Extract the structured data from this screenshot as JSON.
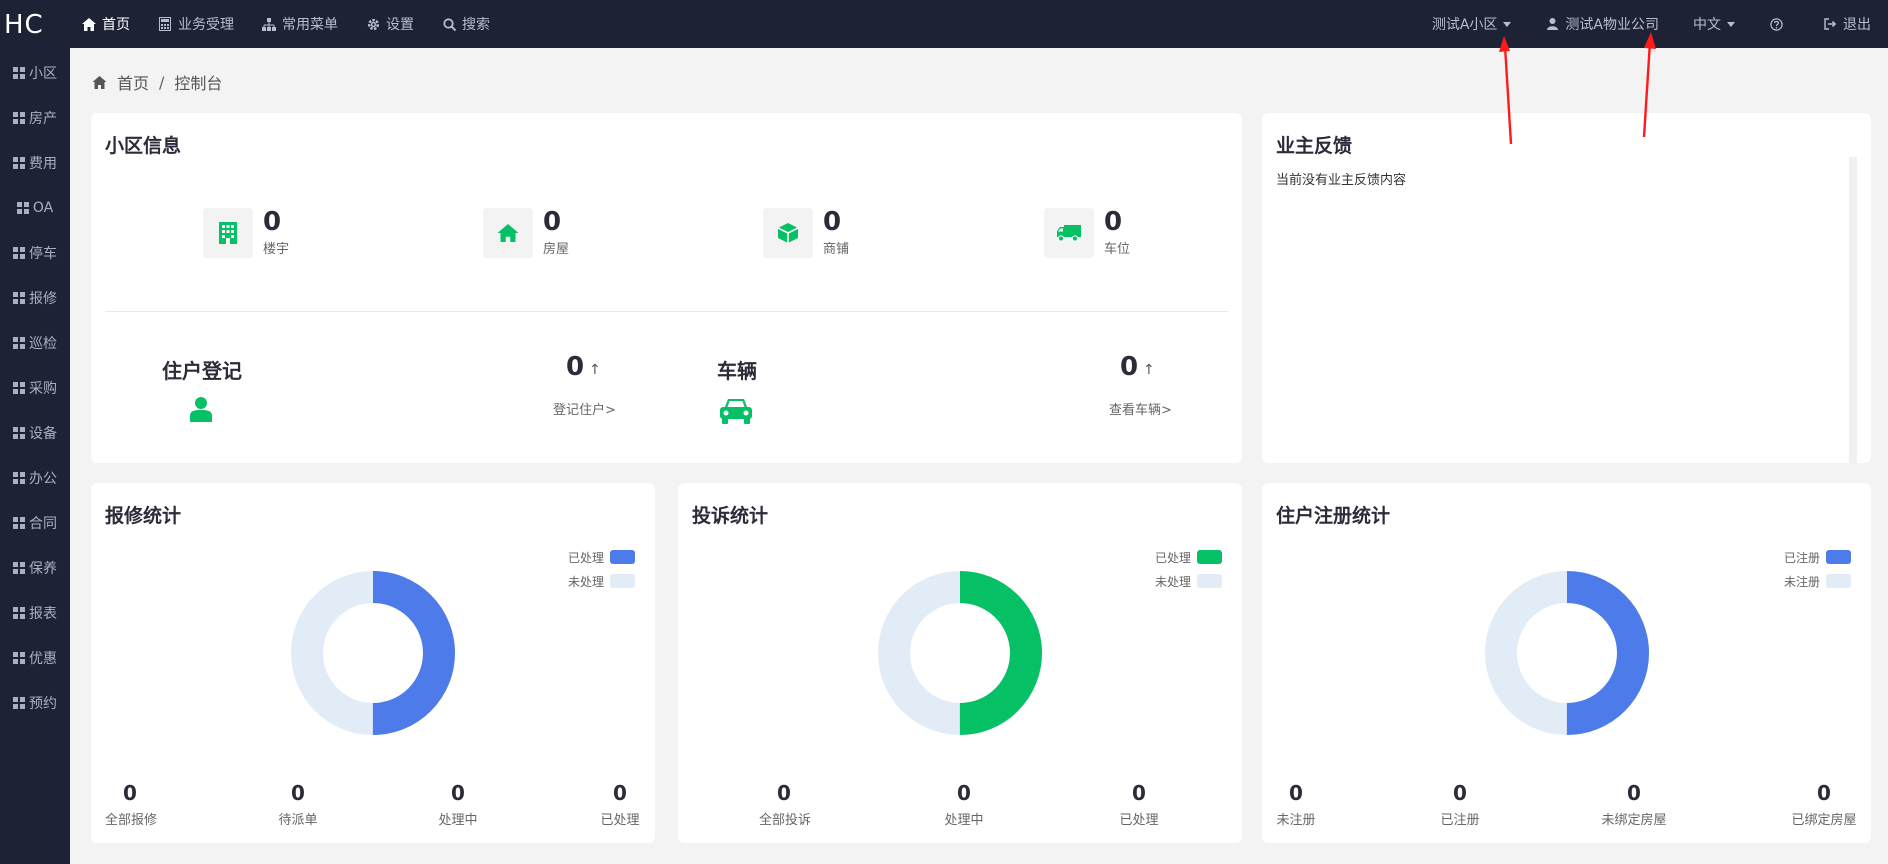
{
  "app": {
    "logo": "HC"
  },
  "topnav": {
    "items": [
      {
        "label": "首页",
        "icon": "home-icon",
        "active": true
      },
      {
        "label": "业务受理",
        "icon": "calculator-icon"
      },
      {
        "label": "常用菜单",
        "icon": "sitemap-icon"
      },
      {
        "label": "设置",
        "icon": "gear-icon"
      },
      {
        "label": "搜索",
        "icon": "search-icon"
      }
    ],
    "community": "测试A小区",
    "company": "测试A物业公司",
    "language": "中文",
    "help_icon": "question-icon",
    "logout": "退出"
  },
  "sidebar": {
    "items": [
      "小区",
      "房产",
      "费用",
      "OA",
      "停车",
      "报修",
      "巡检",
      "采购",
      "设备",
      "办公",
      "合同",
      "保养",
      "报表",
      "优惠",
      "预约"
    ]
  },
  "breadcrumb": {
    "home": "首页",
    "sep": "/",
    "current": "控制台"
  },
  "community_info": {
    "title": "小区信息",
    "stats": [
      {
        "value": "0",
        "label": "楼宇",
        "icon": "building-icon"
      },
      {
        "value": "0",
        "label": "房屋",
        "icon": "house-icon"
      },
      {
        "value": "0",
        "label": "商铺",
        "icon": "cube-icon"
      },
      {
        "value": "0",
        "label": "车位",
        "icon": "truck-icon"
      }
    ],
    "resident": {
      "title": "住户登记",
      "value": "0",
      "arrow": "↑",
      "link": "登记住户>"
    },
    "vehicle": {
      "title": "车辆",
      "value": "0",
      "arrow": "↑",
      "link": "查看车辆>"
    }
  },
  "feedback": {
    "title": "业主反馈",
    "empty_text": "当前没有业主反馈内容"
  },
  "repair": {
    "title": "报修统计",
    "legend": [
      "已处理",
      "未处理"
    ],
    "processed_fraction": 0.5,
    "stats": [
      {
        "value": "0",
        "label": "全部报修"
      },
      {
        "value": "0",
        "label": "待派单"
      },
      {
        "value": "0",
        "label": "处理中"
      },
      {
        "value": "0",
        "label": "已处理"
      }
    ]
  },
  "complaint": {
    "title": "投诉统计",
    "legend": [
      "已处理",
      "未处理"
    ],
    "processed_fraction": 0.5,
    "stats": [
      {
        "value": "0",
        "label": "全部投诉"
      },
      {
        "value": "0",
        "label": "处理中"
      },
      {
        "value": "0",
        "label": "已处理"
      }
    ]
  },
  "registration": {
    "title": "住户注册统计",
    "legend": [
      "已注册",
      "未注册"
    ],
    "registered_fraction": 0.5,
    "stats": [
      {
        "value": "0",
        "label": "未注册"
      },
      {
        "value": "0",
        "label": "已注册"
      },
      {
        "value": "0",
        "label": "未绑定房屋"
      },
      {
        "value": "0",
        "label": "已绑定房屋"
      }
    ]
  },
  "colors": {
    "blue": "#4e7bea",
    "green": "#06c065",
    "light": "#e2ecf6",
    "navbar": "#1e2235"
  }
}
